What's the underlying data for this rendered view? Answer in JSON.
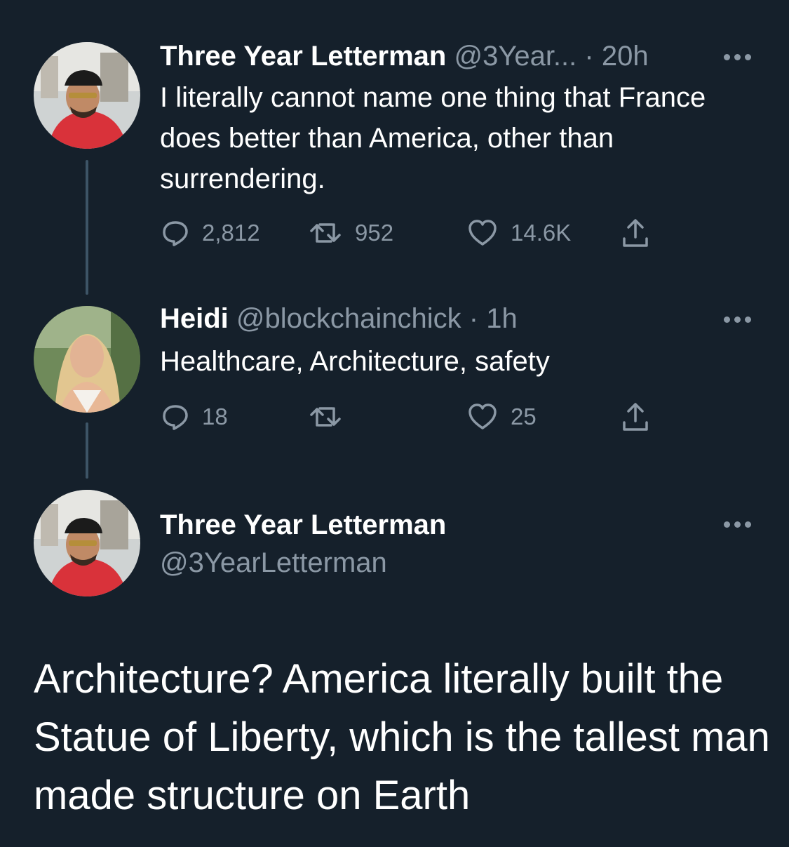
{
  "tweets": [
    {
      "name": "Three Year Letterman",
      "handle": "@3Year...",
      "sep": " · ",
      "time": "20h",
      "text": "I literally cannot name one thing that France does better than America, other than surrendering.",
      "replies": "2,812",
      "retweets": "952",
      "likes": "14.6K"
    },
    {
      "name": "Heidi",
      "handle": "@blockchainchick",
      "sep": " · ",
      "time": "1h",
      "text": "Healthcare, Architecture, safety",
      "replies": "18",
      "retweets": "",
      "likes": "25"
    }
  ],
  "main": {
    "name": "Three Year Letterman",
    "handle": "@3YearLetterman",
    "text": "Architecture? America literally built the Statue of Liberty, which is the tallest man made structure on Earth"
  },
  "colors": {
    "background": "#15202b",
    "text": "#ffffff",
    "muted": "#8b98a5",
    "thread_line": "#3d5466"
  },
  "icons": [
    "reply-icon",
    "retweet-icon",
    "like-icon",
    "share-icon",
    "more-icon"
  ]
}
